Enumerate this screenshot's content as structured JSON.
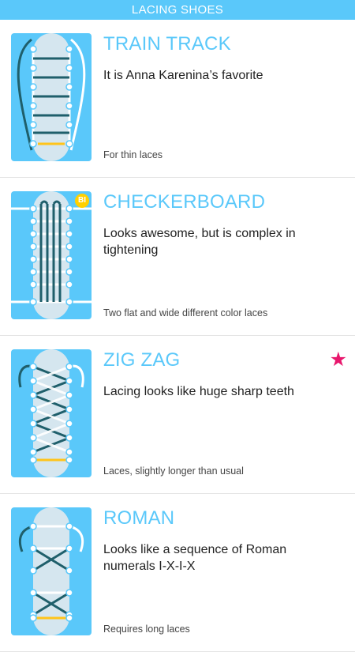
{
  "header": {
    "title": "LACING SHOES"
  },
  "items": [
    {
      "title": "TRAIN TRACK",
      "description": "It is Anna Karenina’s favorite",
      "note": "For thin laces",
      "icon": "train-track-lacing-icon"
    },
    {
      "title": "CHECKERBOARD",
      "description": "Looks awesome, but is complex in tightening",
      "note": "Two flat and wide different color laces",
      "badge": "BI",
      "icon": "checkerboard-lacing-icon"
    },
    {
      "title": "ZIG ZAG",
      "description": "Lacing looks like huge sharp teeth",
      "note": "Laces, slightly longer than usual",
      "favorite": "★",
      "icon": "zig-zag-lacing-icon"
    },
    {
      "title": "ROMAN",
      "description": "Looks like a sequence of Roman numerals I-X-I-X",
      "note": "Requires long laces",
      "icon": "roman-lacing-icon"
    }
  ],
  "colors": {
    "accent": "#5ac8fa",
    "lace_dark": "#1f5f6b",
    "lace_light": "#ffffff",
    "tongue": "#d5e6ef",
    "highlight": "#ffc41a",
    "star": "#e8176d"
  }
}
